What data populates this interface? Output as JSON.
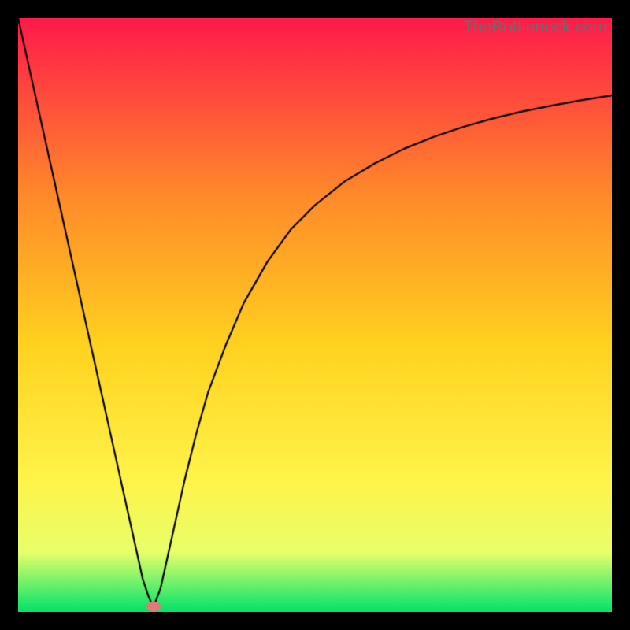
{
  "watermark": "TheBottleneck.com",
  "chart_data": {
    "type": "line",
    "title": "",
    "xlabel": "",
    "ylabel": "",
    "xlim": [
      0,
      100
    ],
    "ylim": [
      0,
      100
    ],
    "grid": false,
    "legend": false,
    "background_gradient": {
      "top": "#ff1a4b",
      "mid_upper": "#ff8a2a",
      "mid": "#ffd21f",
      "mid_lower": "#fff44a",
      "lower": "#e8ff6a",
      "bottom": "#00e36a"
    },
    "marker": {
      "x": 22.8,
      "y": 0.9,
      "color": "#e37a7a"
    },
    "series": [
      {
        "name": "curve",
        "x": [
          0,
          2,
          4,
          6,
          8,
          10,
          12,
          14,
          16,
          18,
          20,
          21,
          22,
          22.8,
          24,
          26,
          28,
          30,
          32,
          35,
          38,
          42,
          46,
          50,
          55,
          60,
          65,
          70,
          75,
          80,
          85,
          90,
          95,
          100
        ],
        "y": [
          100,
          91,
          82,
          73,
          64,
          55,
          46,
          37,
          28,
          19,
          10,
          5.5,
          2.5,
          0.8,
          4,
          13,
          22,
          30,
          37,
          45,
          52,
          59,
          64.5,
          68.5,
          72.5,
          75.5,
          78,
          80,
          81.7,
          83.1,
          84.3,
          85.3,
          86.2,
          87
        ]
      }
    ]
  }
}
